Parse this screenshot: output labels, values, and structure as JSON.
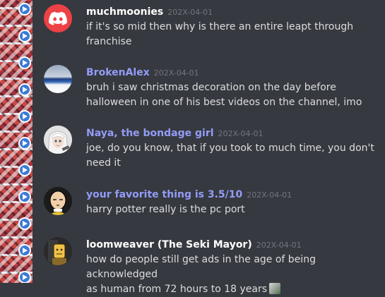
{
  "theme": {
    "background": "#36393f",
    "text": "#dcddde",
    "timestamp": "#72767d",
    "discord_red": "#ed4245"
  },
  "messages": [
    {
      "username": "muchmoonies",
      "color": "#ffffff",
      "timestamp": "202X-04-01",
      "avatar": "discord-logo",
      "lines": [
        "if it's so mid then why is there an entire leapt through",
        "franchise"
      ]
    },
    {
      "username": "BrokenAlex",
      "color": "#949cf7",
      "timestamp": "202X-04-01",
      "avatar": "sky-landscape",
      "lines": [
        "bruh i saw christmas decoration on the day before",
        "halloween in one of his best videos on the channel, imo"
      ]
    },
    {
      "username": "Naya, the bondage girl",
      "color": "#949cf7",
      "timestamp": "202X-04-01",
      "avatar": "anime-girl",
      "lines": [
        "joe, do you know, that if you took to much time, you don't",
        "need it"
      ]
    },
    {
      "username": "your favorite thing is 3.5/10",
      "color": "#949cf7",
      "timestamp": "202X-04-01",
      "avatar": "bald-hero",
      "lines": [
        "harry potter really is the pc port"
      ]
    },
    {
      "username": "loomweaver (The Seki Mayor)",
      "color": "#ffffff",
      "timestamp": "202X-04-01",
      "avatar": "mayor-figure",
      "lines": [
        "how do people still get ads in the age of being acknowledged",
        "as human from 72 hours to 18 years"
      ],
      "trailing_emoji": "pepe-emoji"
    }
  ]
}
